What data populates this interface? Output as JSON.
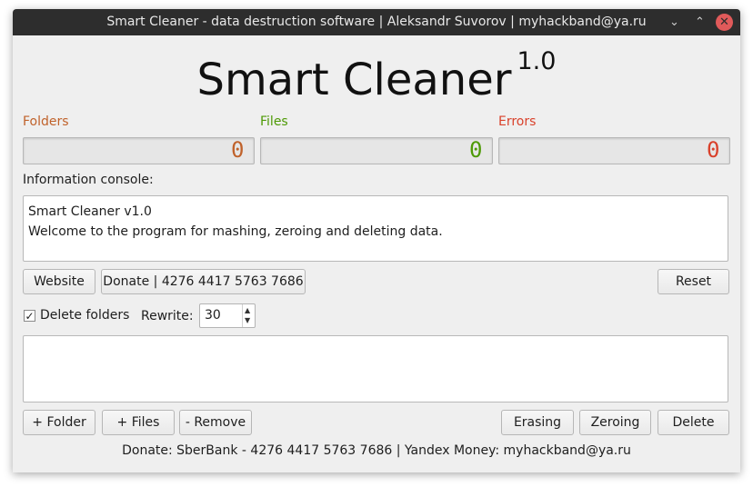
{
  "window": {
    "title": "Smart Cleaner - data destruction software | Aleksandr Suvorov | myhackband@ya.ru",
    "controls": {
      "minimize": "⌄",
      "maximize": "⌃",
      "close": "✕"
    }
  },
  "header": {
    "app_name": "Smart Cleaner",
    "version": "1.0"
  },
  "counters": [
    {
      "label": "Folders",
      "value": "0",
      "color": "#c0622b"
    },
    {
      "label": "Files",
      "value": "0",
      "color": "#4e9a06"
    },
    {
      "label": "Errors",
      "value": "0",
      "color": "#d9412b"
    }
  ],
  "console": {
    "label": "Information console:",
    "lines": [
      "Smart Cleaner v1.0",
      "Welcome to the program for mashing, zeroing and deleting data."
    ]
  },
  "buttons": {
    "website": "Website",
    "donate": "Donate | 4276 4417 5763 7686",
    "reset": "Reset",
    "add_folder": "+ Folder",
    "add_files": "+ Files",
    "remove": "- Remove",
    "erasing": "Erasing",
    "zeroing": "Zeroing",
    "delete": "Delete"
  },
  "options": {
    "delete_folders_label": "Delete folders",
    "delete_folders_checked": true,
    "check_mark": "✓",
    "rewrite_label": "Rewrite:",
    "rewrite_value": "30"
  },
  "footer": "Donate: SberBank - 4276 4417 5763 7686 | Yandex Money: myhackband@ya.ru"
}
